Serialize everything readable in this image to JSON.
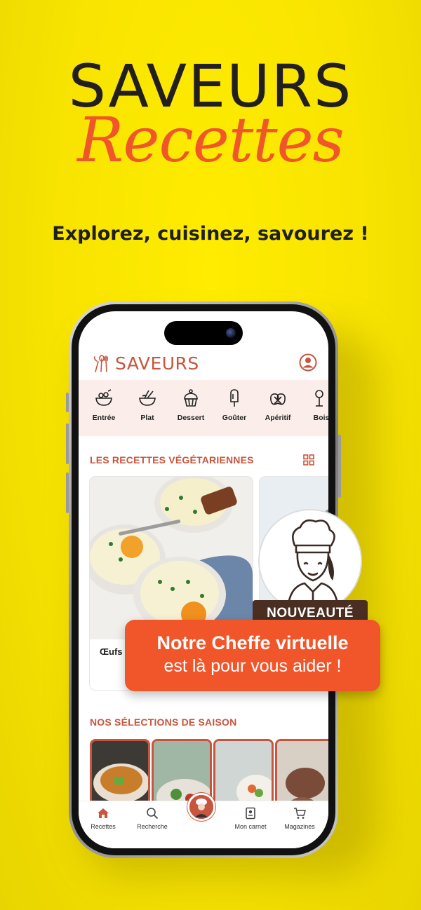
{
  "brand": {
    "title_top": "SAVEURS",
    "title_script": "Recettes"
  },
  "tagline": "Explorez, cuisinez, savourez !",
  "app": {
    "logo": "SAVEURS",
    "categories": [
      {
        "label": "Entrée",
        "icon": "salad-bowl-icon"
      },
      {
        "label": "Plat",
        "icon": "noodle-bowl-icon"
      },
      {
        "label": "Dessert",
        "icon": "cupcake-icon"
      },
      {
        "label": "Goûter",
        "icon": "ice-pop-icon"
      },
      {
        "label": "Apéritif",
        "icon": "pretzel-icon"
      },
      {
        "label": "Bois",
        "icon": "drink-icon"
      }
    ],
    "section_vegetarian": "LES RECETTES VÉGÉTARIENNES",
    "card_title": "Œufs",
    "section_season": "NOS SÉLECTIONS DE SAISON",
    "tabs": [
      {
        "label": "Recettes",
        "icon": "home-icon"
      },
      {
        "label": "Recherche",
        "icon": "search-icon"
      },
      {
        "label": "",
        "icon": "chef-icon"
      },
      {
        "label": "Mon carnet",
        "icon": "notebook-icon"
      },
      {
        "label": "Magazines",
        "icon": "cart-icon"
      }
    ]
  },
  "promo": {
    "badge": "NOUVEAUTÉ",
    "line1": "Notre Cheffe virtuelle",
    "line2": "est là pour vous aider !"
  },
  "colors": {
    "background": "#f7e300",
    "accent": "#c8553d",
    "promo": "#f0562a",
    "badge": "#4a2e22"
  }
}
